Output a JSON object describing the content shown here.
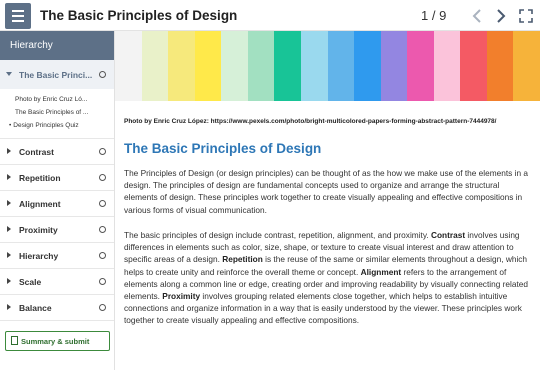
{
  "topbar": {
    "title": "The Basic Principles of Design",
    "page_count": "1 / 9",
    "icons": {
      "menu": "hamburger-menu-icon",
      "prev": "chevron-left-icon",
      "next": "chevron-right-icon",
      "expand": "expand-icon"
    }
  },
  "sidebar": {
    "header": "Hierarchy",
    "active_item": "The Basic Princi...",
    "subitems": [
      "Photo by Enric Cruz Ló...",
      "The Basic Principles of ...",
      "Design Principles Quiz"
    ],
    "items": [
      "Contrast",
      "Repetition",
      "Alignment",
      "Proximity",
      "Hierarchy",
      "Scale",
      "Balance"
    ],
    "summary_button": "Summary & submit"
  },
  "main": {
    "hero_colors": [
      "#f3f3f3",
      "#e9f1c9",
      "#f6e97c",
      "#ffe94a",
      "#d6f0d8",
      "#a2e0c1",
      "#18c497",
      "#9ad9ee",
      "#62b4ea",
      "#2f9aee",
      "#9386e1",
      "#ec59ae",
      "#fbc3da",
      "#f45a64",
      "#f27f2c",
      "#f6b33a"
    ],
    "caption": "Photo by Enric Cruz López: https://www.pexels.com/photo/bright-multicolored-papers-forming-abstract-pattern-7444978/",
    "heading": "The Basic Principles of Design",
    "para1": "The Principles of Design (or design principles) can be thought of as the how we make use of the elements in a design. The principles of design are fundamental concepts used to organize and arrange the structural elements of design. These principles work together to create visually appealing and effective compositions in various forms of visual communication.",
    "para2": {
      "intro": "The basic principles of design include contrast, repetition, alignment, and proximity. ",
      "t1": "Contrast",
      "s1": " involves using differences in elements such as color, size, shape, or texture to create visual interest and draw attention to specific areas of a design. ",
      "t2": "Repetition",
      "s2": " is the reuse of the same or similar elements throughout a design, which helps to create unity and reinforce the overall theme or concept. ",
      "t3": "Alignment",
      "s3": " refers to the arrangement of elements along a common line or edge, creating order and improving readability by visually connecting related elements. ",
      "t4": "Proximity",
      "s4": " involves grouping related elements close together, which helps to establish intuitive connections and organize information in a way that is easily understood by the viewer. These principles work together to create visually appealing and effective compositions."
    }
  },
  "colors": {
    "accent": "#5d7087",
    "heading": "#2e77b6",
    "summary": "#3c8a3c"
  }
}
